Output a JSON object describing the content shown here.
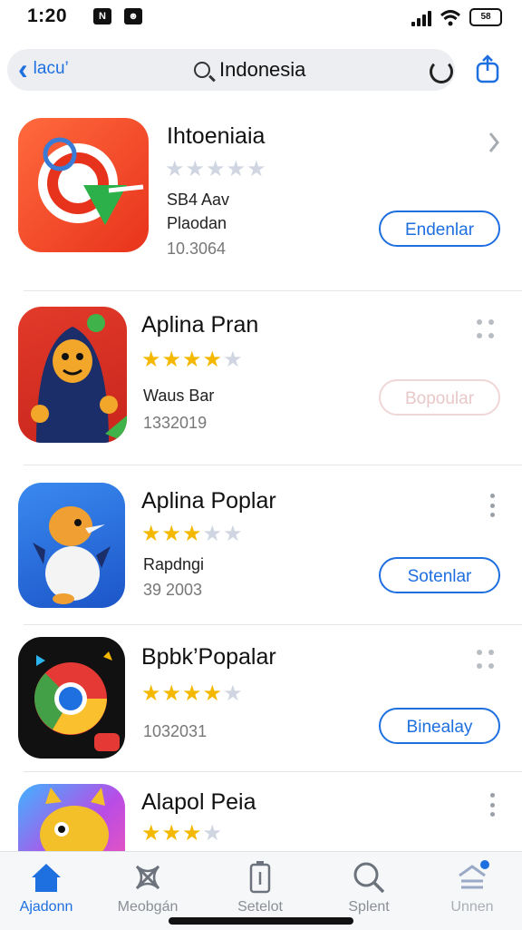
{
  "status": {
    "time": "1:20",
    "battery": "58"
  },
  "nav": {
    "back_label": "lacu’",
    "query": "Indonesia"
  },
  "apps": [
    {
      "title": "Ihtoeniaia",
      "rating": 0,
      "info": "SB4 Aav",
      "info2": "Plaodan",
      "count": "10.3064",
      "button": "Endenlar",
      "button_state": "normal"
    },
    {
      "title": "Aplina Pran",
      "rating": 4.5,
      "info": "Waus Bar",
      "info2": "",
      "count": "1332019",
      "button": "Bopoular",
      "button_state": "faded"
    },
    {
      "title": "Aplina Poplar",
      "rating": 3.5,
      "info": "Rapdngi",
      "info2": "",
      "count": "39 2003",
      "button": "Sotenlar",
      "button_state": "normal"
    },
    {
      "title": "Bpbk’Popalar",
      "rating": 4,
      "info": "",
      "info2": "",
      "count": "1032031",
      "button": "Binealay",
      "button_state": "normal"
    },
    {
      "title": "Alapol Peia",
      "rating": 3,
      "info": "",
      "info2": "",
      "count": "",
      "button": "",
      "button_state": "normal"
    }
  ],
  "tabs": [
    {
      "label": "Ajadonn",
      "icon": "home-icon",
      "active": true
    },
    {
      "label": "Meobgán",
      "icon": "games-icon",
      "active": false
    },
    {
      "label": "Setelot",
      "icon": "apps-icon",
      "active": false
    },
    {
      "label": "Splent",
      "icon": "search-icon",
      "active": false
    },
    {
      "label": "Unnen",
      "icon": "updates-icon",
      "active": false
    }
  ],
  "colors": {
    "accent": "#1e6fe0",
    "star": "#f5b800"
  }
}
